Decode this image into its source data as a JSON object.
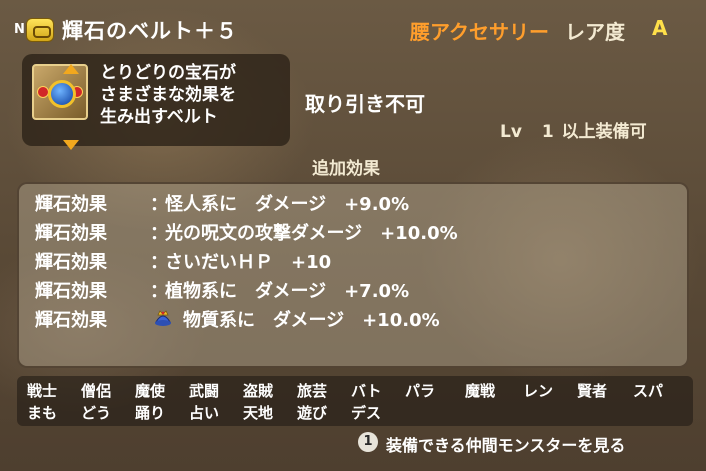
{
  "header": {
    "n_mark": "N",
    "item_name": "輝石のベルト＋５",
    "category": "腰アクセサリー",
    "rarity_label": "レア度",
    "rarity_value": "A"
  },
  "item": {
    "icon": "gem-belt-icon",
    "description": "とりどりの宝石が\nさまざまな効果を\n生み出すベルト",
    "trade": "取り引き不可",
    "level_label": "Lv",
    "level_value": "1",
    "level_suffix": "以上装備可"
  },
  "effects": {
    "title": "追加効果",
    "rows": [
      {
        "label": "輝石効果",
        "text": "怪人系に　ダメージ　+9.0%"
      },
      {
        "label": "輝石効果",
        "text": "光の呪文の攻撃ダメージ　+10.0%"
      },
      {
        "label": "輝石効果",
        "text": "さいだいＨＰ　+10"
      },
      {
        "label": "輝石効果",
        "text": "植物系に　ダメージ　+7.0%"
      },
      {
        "label": "輝石効果",
        "text": "物質系に　ダメージ　+10.0%",
        "icon": "king-slime-icon"
      }
    ]
  },
  "jobs": {
    "row1": [
      "戦士",
      "僧侶",
      "魔使",
      "武闘",
      "盗賊",
      "旅芸",
      "バト",
      "パラ",
      "魔戦",
      "レン",
      "賢者",
      "スパ"
    ],
    "row2": [
      "まも",
      "どう",
      "踊り",
      "占い",
      "天地",
      "遊び",
      "デス"
    ]
  },
  "footer": {
    "button": "1",
    "hint": "装備できる仲間モンスターを見る"
  },
  "colors": {
    "category": "#ff9e2c",
    "rarity": "#ffe04a",
    "panel": "#2d2319"
  }
}
